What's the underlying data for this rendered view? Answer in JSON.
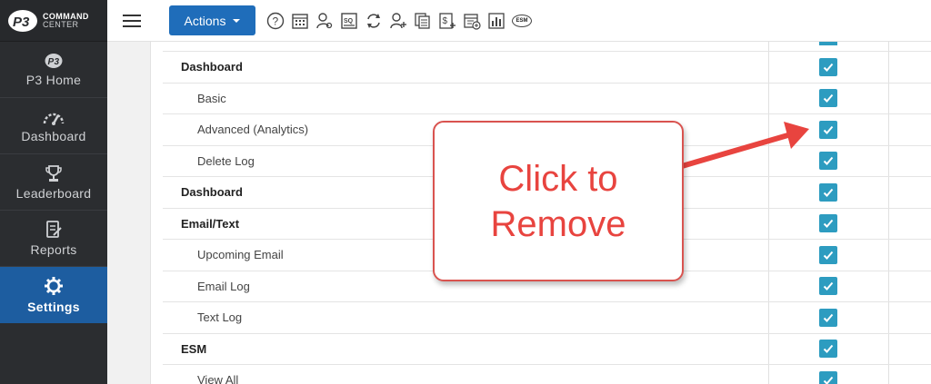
{
  "brand": {
    "line1": "COMMAND",
    "line2": "CENTER",
    "logo_text": "P3"
  },
  "sidebar": {
    "items": [
      {
        "label": "P3 Home",
        "icon": "p3-logo-icon",
        "active": false
      },
      {
        "label": "Dashboard",
        "icon": "gauge-icon",
        "active": false
      },
      {
        "label": "Leaderboard",
        "icon": "trophy-icon",
        "active": false
      },
      {
        "label": "Reports",
        "icon": "report-icon",
        "active": false
      },
      {
        "label": "Settings",
        "icon": "gear-icon",
        "active": true
      }
    ]
  },
  "topbar": {
    "actions_label": "Actions",
    "icons": [
      "help-icon",
      "calendar-icon",
      "user-search-icon",
      "sq-search-icon",
      "refresh-icon",
      "add-user-icon",
      "documents-icon",
      "dollar-plus-icon",
      "calendar-plus-icon",
      "bar-chart-icon",
      "esm-icon"
    ],
    "esm_label": "ESM"
  },
  "permissions": {
    "rows": [
      {
        "label": "Dashboard",
        "type": "header",
        "checked": true
      },
      {
        "label": "Basic",
        "type": "child",
        "checked": true
      },
      {
        "label": "Advanced (Analytics)",
        "type": "child",
        "checked": true
      },
      {
        "label": "Delete Log",
        "type": "child",
        "checked": true
      },
      {
        "label": "Dashboard",
        "type": "header",
        "checked": true
      },
      {
        "label": "Email/Text",
        "type": "header",
        "checked": true
      },
      {
        "label": "Upcoming Email",
        "type": "child",
        "checked": true
      },
      {
        "label": "Email Log",
        "type": "child",
        "checked": true
      },
      {
        "label": "Text Log",
        "type": "child",
        "checked": true
      },
      {
        "label": "ESM",
        "type": "header",
        "checked": true
      },
      {
        "label": "View All",
        "type": "child",
        "checked": true
      }
    ]
  },
  "callout": {
    "line1": "Click to",
    "line2": "Remove"
  },
  "colors": {
    "sidebar": "#2b2d30",
    "active": "#1d5da0",
    "button": "#1f6dba",
    "checkbox": "#2d9cc0",
    "callout_red": "#e8443f"
  }
}
